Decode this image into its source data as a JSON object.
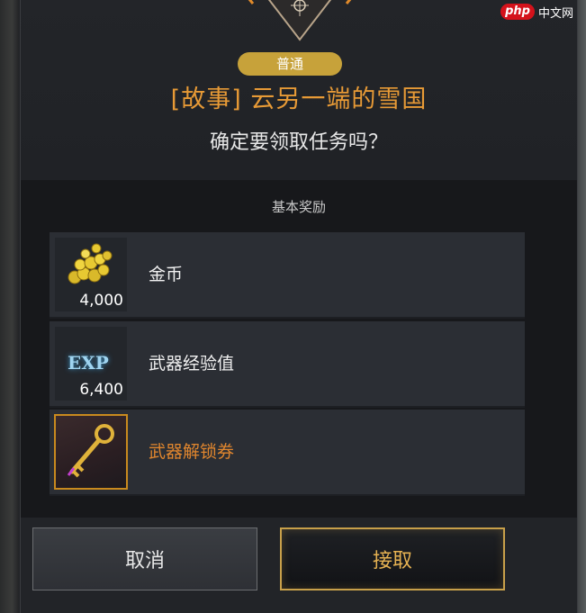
{
  "watermark": {
    "logo": "php",
    "text": "中文网"
  },
  "header": {
    "grade": "普通",
    "title": "[故事] 云另一端的雪国",
    "confirm": "确定要领取任务吗？"
  },
  "rewards": {
    "section_label": "基本奖励",
    "items": [
      {
        "name": "金币",
        "quantity": "4,000",
        "icon": "gold-coins-icon"
      },
      {
        "name": "武器经验值",
        "quantity": "6,400",
        "icon": "exp-icon",
        "icon_text": "EXP"
      },
      {
        "name": "武器解锁券",
        "quantity": "",
        "icon": "golden-key-icon"
      }
    ]
  },
  "buttons": {
    "cancel": "取消",
    "accept": "接取"
  },
  "colors": {
    "accent": "#e79a36",
    "badge": "#c7a23a",
    "accept_border": "#c8a04a"
  }
}
